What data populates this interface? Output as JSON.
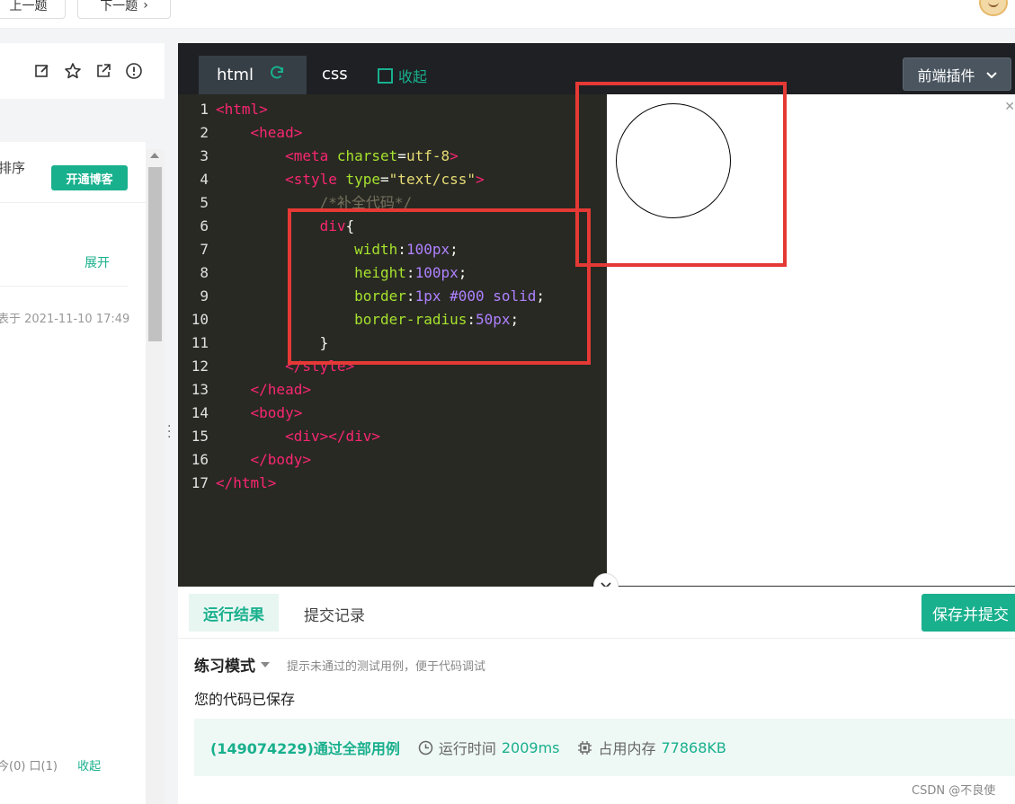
{
  "topbar": {
    "prev_label": "上一题",
    "next_label": "下一题"
  },
  "left_panel": {
    "sort_label": "排序",
    "open_blog_label": "开通博客",
    "expand_label": "展开",
    "date_text": "表于 2021-11-10 17:49",
    "bottom_stats": "今(0)  口(1)",
    "fav_label": "收起"
  },
  "editor": {
    "tab_html": "html",
    "tab_css": "css",
    "collapse_label": "收起",
    "plugin_label": "前端插件",
    "lines": [
      "1",
      "2",
      "3",
      "4",
      "5",
      "6",
      "7",
      "8",
      "9",
      "10",
      "11",
      "12",
      "13",
      "14",
      "15",
      "16",
      "17"
    ]
  },
  "result": {
    "tab_active": "运行结果",
    "tab_history": "提交记录",
    "save_submit_label": "保存并提交",
    "mode_label": "练习模式",
    "hint_text": "提示未通过的测试用例，便于代码调试",
    "saved_text": "您的代码已保存",
    "pass_text": "(149074229)通过全部用例",
    "runtime_label": "运行时间",
    "runtime_value": "2009ms",
    "memory_label": "占用内存",
    "memory_value": "77868KB"
  },
  "watermark": "CSDN @不良使"
}
